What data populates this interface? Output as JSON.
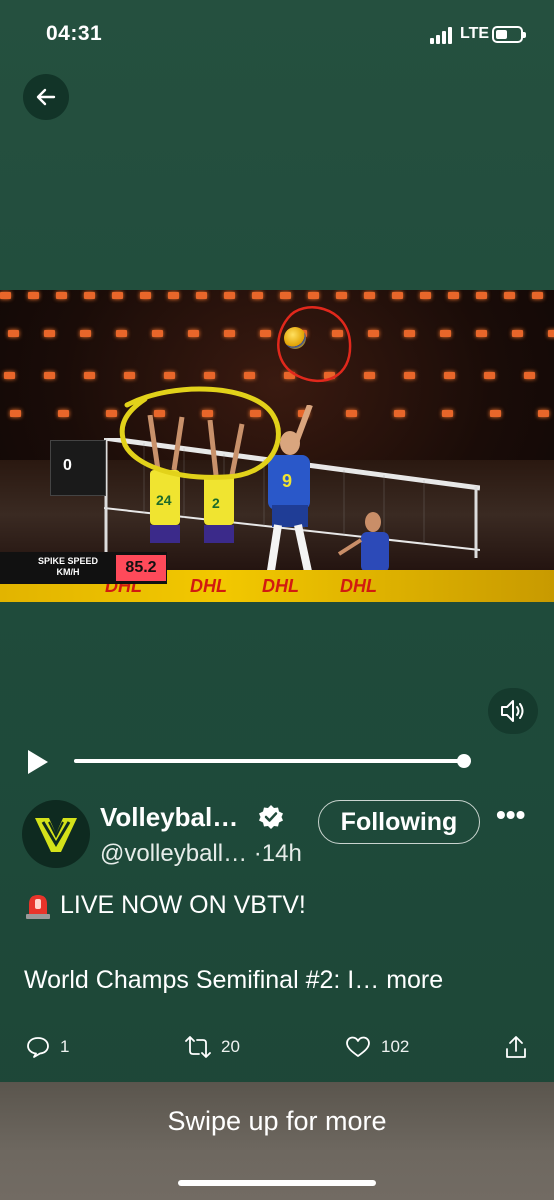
{
  "status_bar": {
    "time": "04:31",
    "network": "LTE"
  },
  "video": {
    "spike_speed_label_line1": "SPIKE SPEED",
    "spike_speed_label_line2": "KM/H",
    "spike_speed_value": "85.2",
    "banner_text": "DHL",
    "jersey_numbers": [
      "24",
      "2",
      "9"
    ],
    "scoreboard_value": "0",
    "progress_fraction": 0.99
  },
  "tweet": {
    "display_name": "Volleybal…",
    "handle": "@volleyball…",
    "time_ago": "·14h",
    "follow_label": "Following",
    "more_options": "•••",
    "line1": "LIVE NOW ON VBTV!",
    "line2": "World Champs Semifinal #2: I…",
    "more_link": "more",
    "replies": "1",
    "retweets": "20",
    "likes": "102"
  },
  "bottom": {
    "swipe_text": "Swipe up for more"
  },
  "icons": {
    "back": "arrow-left-icon",
    "mute": "speaker-muted-icon",
    "play": "play-icon",
    "reply": "reply-icon",
    "retweet": "retweet-icon",
    "like": "heart-icon",
    "share": "share-icon",
    "verified": "verified-badge-icon",
    "siren": "siren-emoji-icon"
  },
  "colors": {
    "background": "#1f4a3a",
    "accent_yellow": "#d4e21a",
    "speed_badge": "#ff4a5a"
  }
}
